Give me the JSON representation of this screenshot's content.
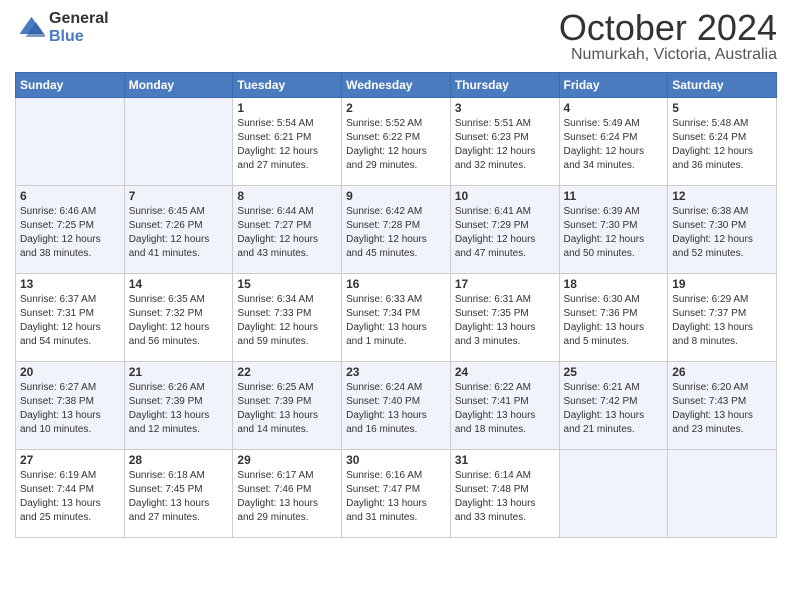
{
  "logo": {
    "general": "General",
    "blue": "Blue"
  },
  "title": "October 2024",
  "location": "Numurkah, Victoria, Australia",
  "headers": [
    "Sunday",
    "Monday",
    "Tuesday",
    "Wednesday",
    "Thursday",
    "Friday",
    "Saturday"
  ],
  "weeks": [
    [
      {
        "day": "",
        "info": ""
      },
      {
        "day": "",
        "info": ""
      },
      {
        "day": "1",
        "info": "Sunrise: 5:54 AM\nSunset: 6:21 PM\nDaylight: 12 hours\nand 27 minutes."
      },
      {
        "day": "2",
        "info": "Sunrise: 5:52 AM\nSunset: 6:22 PM\nDaylight: 12 hours\nand 29 minutes."
      },
      {
        "day": "3",
        "info": "Sunrise: 5:51 AM\nSunset: 6:23 PM\nDaylight: 12 hours\nand 32 minutes."
      },
      {
        "day": "4",
        "info": "Sunrise: 5:49 AM\nSunset: 6:24 PM\nDaylight: 12 hours\nand 34 minutes."
      },
      {
        "day": "5",
        "info": "Sunrise: 5:48 AM\nSunset: 6:24 PM\nDaylight: 12 hours\nand 36 minutes."
      }
    ],
    [
      {
        "day": "6",
        "info": "Sunrise: 6:46 AM\nSunset: 7:25 PM\nDaylight: 12 hours\nand 38 minutes."
      },
      {
        "day": "7",
        "info": "Sunrise: 6:45 AM\nSunset: 7:26 PM\nDaylight: 12 hours\nand 41 minutes."
      },
      {
        "day": "8",
        "info": "Sunrise: 6:44 AM\nSunset: 7:27 PM\nDaylight: 12 hours\nand 43 minutes."
      },
      {
        "day": "9",
        "info": "Sunrise: 6:42 AM\nSunset: 7:28 PM\nDaylight: 12 hours\nand 45 minutes."
      },
      {
        "day": "10",
        "info": "Sunrise: 6:41 AM\nSunset: 7:29 PM\nDaylight: 12 hours\nand 47 minutes."
      },
      {
        "day": "11",
        "info": "Sunrise: 6:39 AM\nSunset: 7:30 PM\nDaylight: 12 hours\nand 50 minutes."
      },
      {
        "day": "12",
        "info": "Sunrise: 6:38 AM\nSunset: 7:30 PM\nDaylight: 12 hours\nand 52 minutes."
      }
    ],
    [
      {
        "day": "13",
        "info": "Sunrise: 6:37 AM\nSunset: 7:31 PM\nDaylight: 12 hours\nand 54 minutes."
      },
      {
        "day": "14",
        "info": "Sunrise: 6:35 AM\nSunset: 7:32 PM\nDaylight: 12 hours\nand 56 minutes."
      },
      {
        "day": "15",
        "info": "Sunrise: 6:34 AM\nSunset: 7:33 PM\nDaylight: 12 hours\nand 59 minutes."
      },
      {
        "day": "16",
        "info": "Sunrise: 6:33 AM\nSunset: 7:34 PM\nDaylight: 13 hours\nand 1 minute."
      },
      {
        "day": "17",
        "info": "Sunrise: 6:31 AM\nSunset: 7:35 PM\nDaylight: 13 hours\nand 3 minutes."
      },
      {
        "day": "18",
        "info": "Sunrise: 6:30 AM\nSunset: 7:36 PM\nDaylight: 13 hours\nand 5 minutes."
      },
      {
        "day": "19",
        "info": "Sunrise: 6:29 AM\nSunset: 7:37 PM\nDaylight: 13 hours\nand 8 minutes."
      }
    ],
    [
      {
        "day": "20",
        "info": "Sunrise: 6:27 AM\nSunset: 7:38 PM\nDaylight: 13 hours\nand 10 minutes."
      },
      {
        "day": "21",
        "info": "Sunrise: 6:26 AM\nSunset: 7:39 PM\nDaylight: 13 hours\nand 12 minutes."
      },
      {
        "day": "22",
        "info": "Sunrise: 6:25 AM\nSunset: 7:39 PM\nDaylight: 13 hours\nand 14 minutes."
      },
      {
        "day": "23",
        "info": "Sunrise: 6:24 AM\nSunset: 7:40 PM\nDaylight: 13 hours\nand 16 minutes."
      },
      {
        "day": "24",
        "info": "Sunrise: 6:22 AM\nSunset: 7:41 PM\nDaylight: 13 hours\nand 18 minutes."
      },
      {
        "day": "25",
        "info": "Sunrise: 6:21 AM\nSunset: 7:42 PM\nDaylight: 13 hours\nand 21 minutes."
      },
      {
        "day": "26",
        "info": "Sunrise: 6:20 AM\nSunset: 7:43 PM\nDaylight: 13 hours\nand 23 minutes."
      }
    ],
    [
      {
        "day": "27",
        "info": "Sunrise: 6:19 AM\nSunset: 7:44 PM\nDaylight: 13 hours\nand 25 minutes."
      },
      {
        "day": "28",
        "info": "Sunrise: 6:18 AM\nSunset: 7:45 PM\nDaylight: 13 hours\nand 27 minutes."
      },
      {
        "day": "29",
        "info": "Sunrise: 6:17 AM\nSunset: 7:46 PM\nDaylight: 13 hours\nand 29 minutes."
      },
      {
        "day": "30",
        "info": "Sunrise: 6:16 AM\nSunset: 7:47 PM\nDaylight: 13 hours\nand 31 minutes."
      },
      {
        "day": "31",
        "info": "Sunrise: 6:14 AM\nSunset: 7:48 PM\nDaylight: 13 hours\nand 33 minutes."
      },
      {
        "day": "",
        "info": ""
      },
      {
        "day": "",
        "info": ""
      }
    ]
  ]
}
